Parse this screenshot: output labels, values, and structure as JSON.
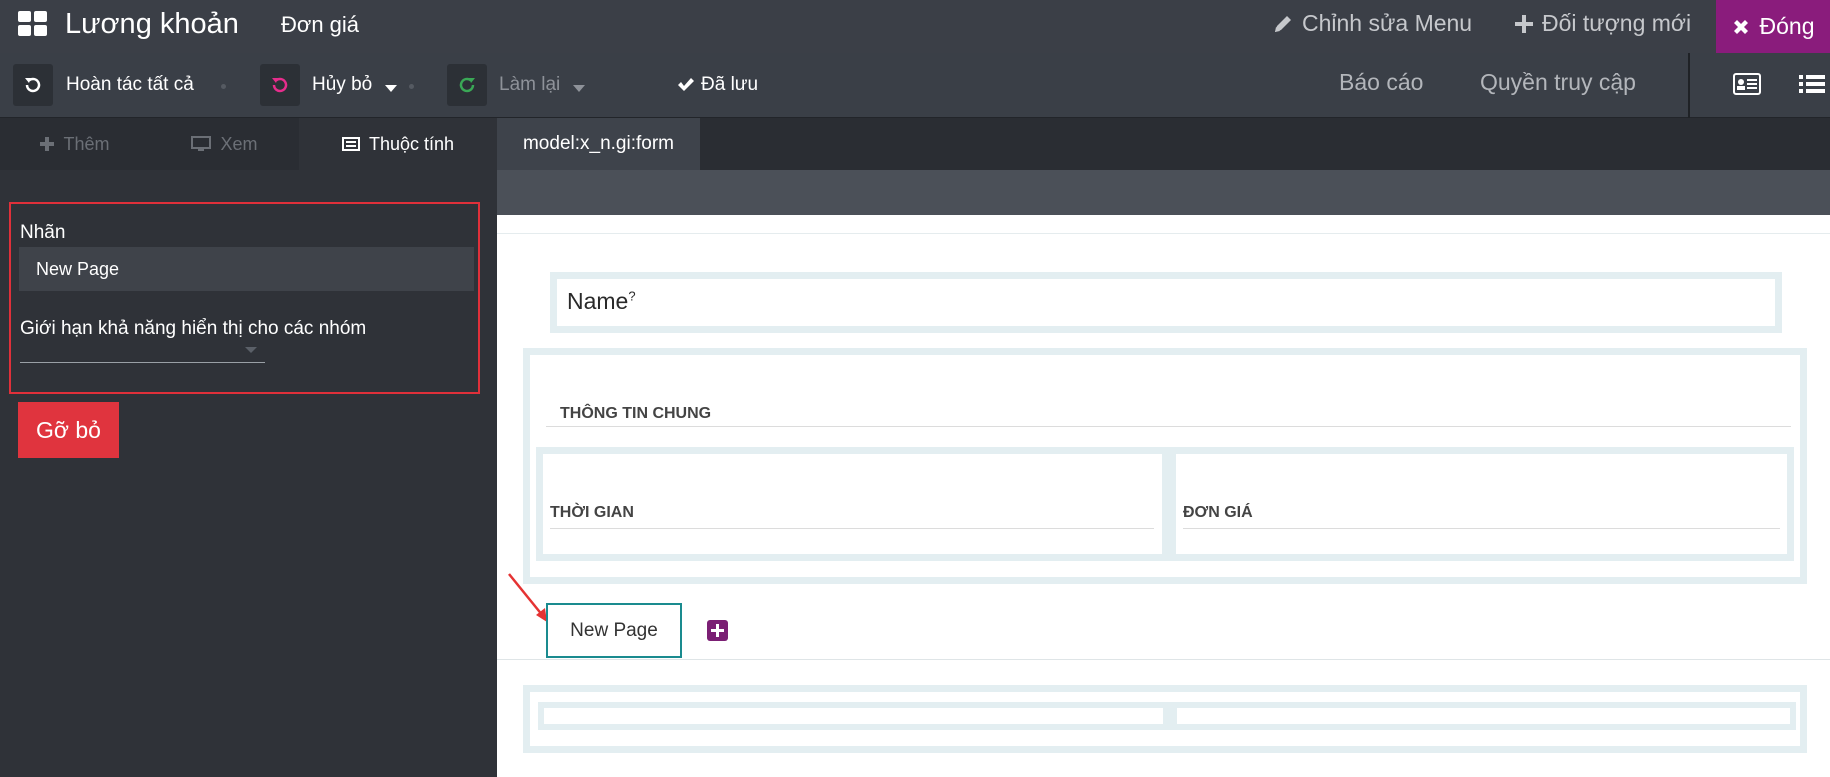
{
  "topbar": {
    "app_title": "Lương khoản",
    "app_sub": "Đơn giá",
    "edit_menu": "Chỉnh sửa Menu",
    "new_object": "Đối tượng mới",
    "close": "Đóng"
  },
  "toolbar": {
    "undo_all": "Hoàn tác tất cả",
    "discard": "Hủy bỏ",
    "redo": "Làm lại",
    "saved": "Đã lưu",
    "reports": "Báo cáo",
    "access": "Quyền truy cập"
  },
  "sidebar": {
    "tabs": [
      "Thêm",
      "Xem",
      "Thuộc tính"
    ],
    "label_caption": "Nhãn",
    "label_value": "New Page",
    "groups_caption": "Giới hạn khả năng hiển thị cho các nhóm",
    "remove": "Gỡ bỏ"
  },
  "content": {
    "tab": "model:x_n.gi:form",
    "name_field": "Name",
    "name_help": "?",
    "section_title": "THÔNG TIN CHUNG",
    "col_left": "THỜI GIAN",
    "col_right": "ĐƠN GIÁ",
    "page_tab": "New Page"
  },
  "colors": {
    "accent": "#8a1c7c",
    "danger": "#e0343e",
    "highlight_border": "#e0303a",
    "selected_tab_border": "#1a8b8f"
  }
}
